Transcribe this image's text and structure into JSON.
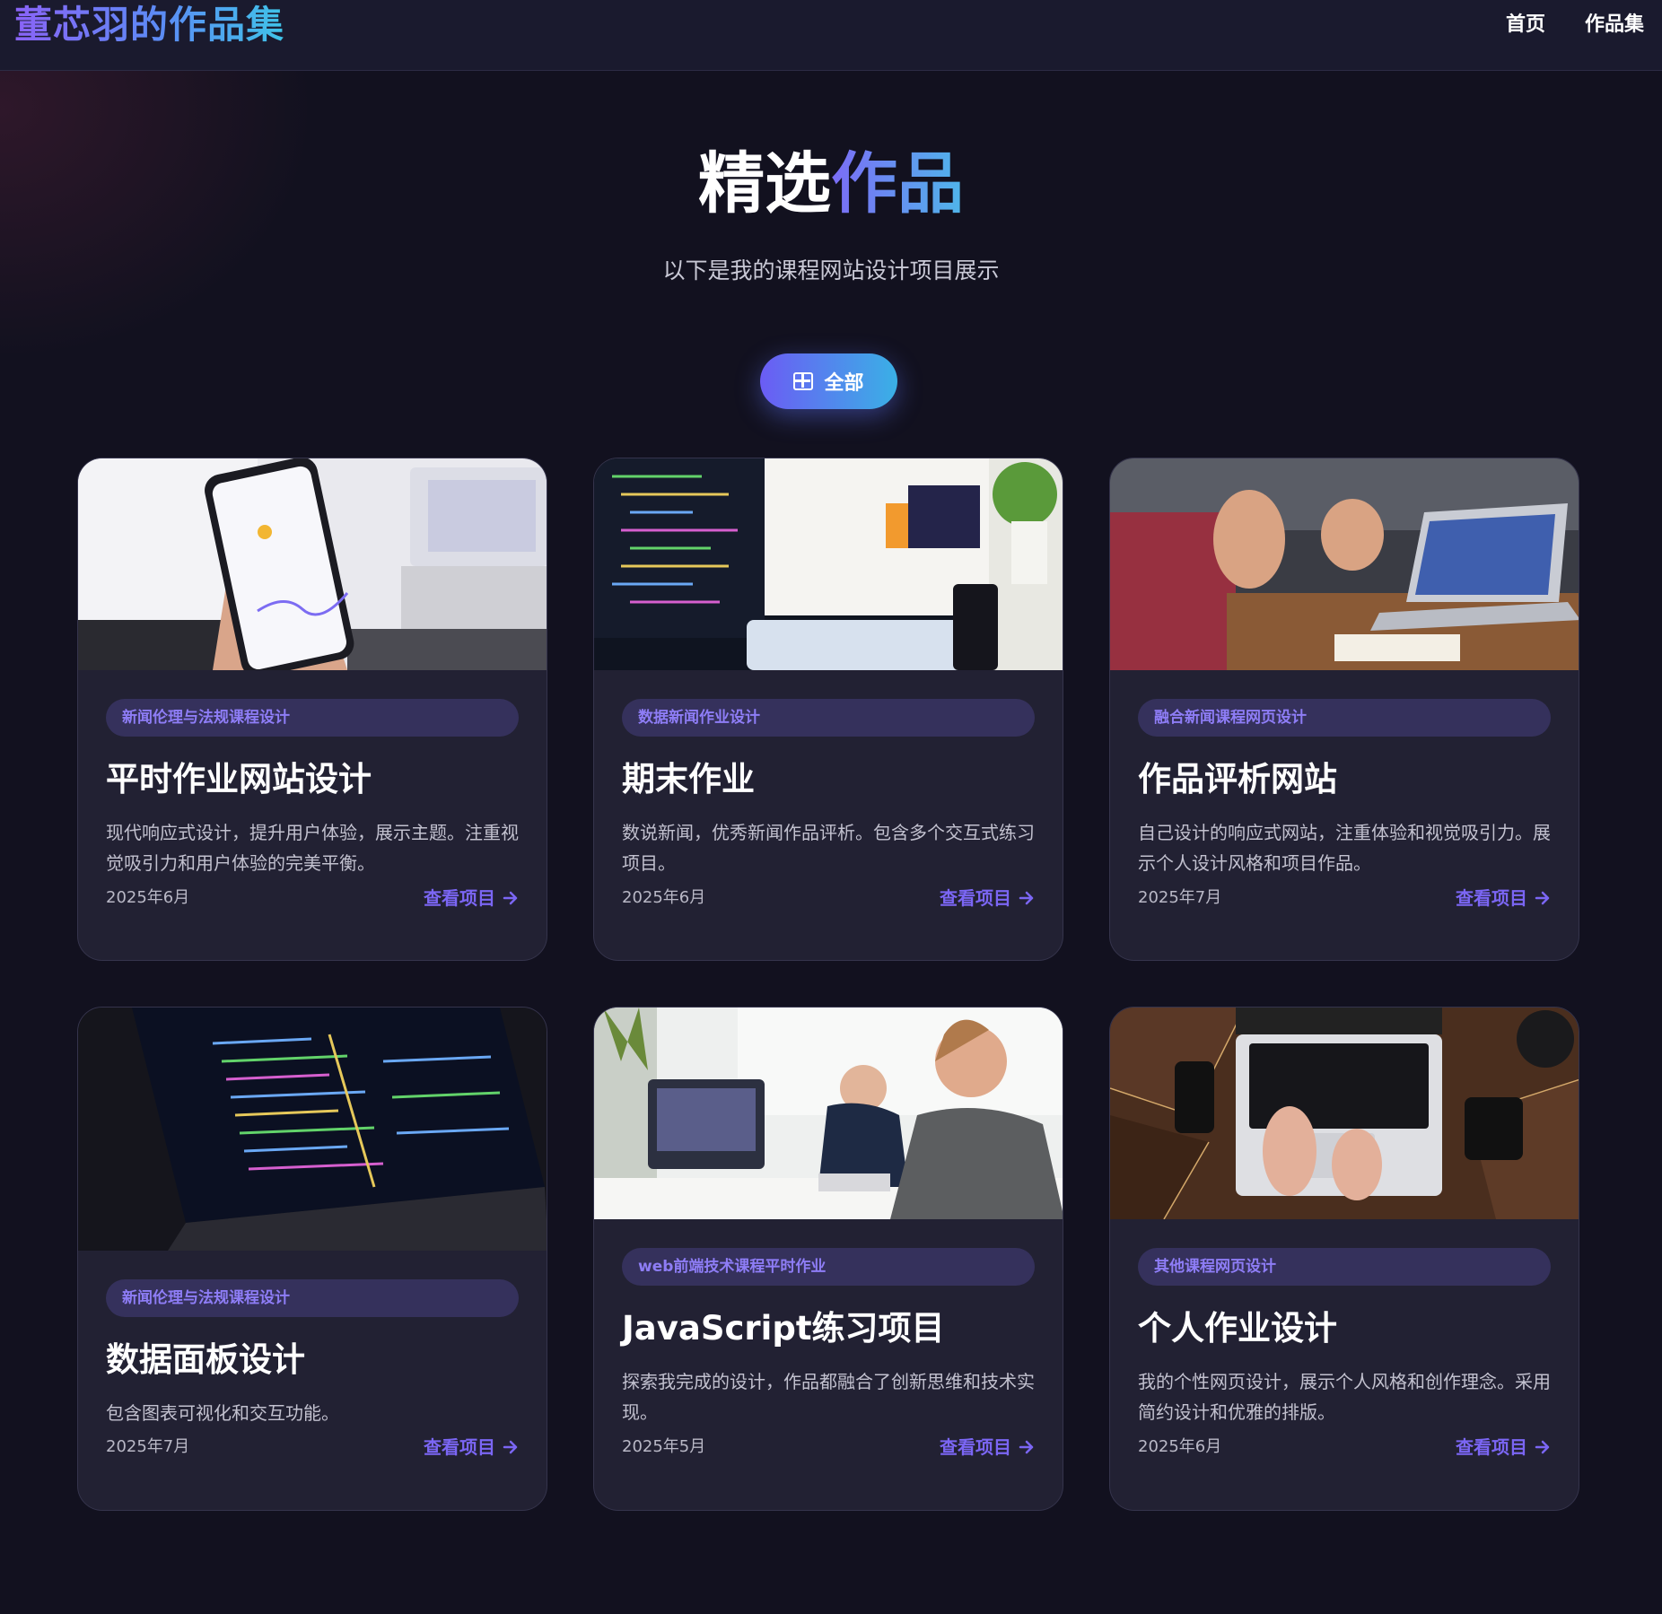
{
  "nav": {
    "brand": "董芯羽的作品集",
    "links": [
      "首页",
      "作品集"
    ]
  },
  "hero": {
    "title_plain": "精选",
    "title_highlight": "作品",
    "subtitle": "以下是我的课程网站设计项目展示",
    "filter_label": "全部"
  },
  "colors": {
    "accent_purple": "#7b66f4",
    "accent_cyan": "#3ab0e6",
    "card_bg": "#222133",
    "page_bg": "#12111f"
  },
  "cards": [
    {
      "image": "phone-dashboard-photo",
      "tag": "新闻伦理与法规课程设计",
      "title": "平时作业网站设计",
      "desc": "现代响应式设计，提升用户体验，展示主题。注重视觉吸引力和用户体验的完美平衡。",
      "date": "2025年6月",
      "link": "查看项目"
    },
    {
      "image": "code-landing-page-photo",
      "tag": "数据新闻作业设计",
      "title": "期末作业",
      "desc": "数说新闻，优秀新闻作品评析。包含多个交互式练习项目。",
      "date": "2025年6月",
      "link": "查看项目"
    },
    {
      "image": "meeting-laptop-photo",
      "tag": "融合新闻课程网页设计",
      "title": "作品评析网站",
      "desc": "自己设计的响应式网站，注重体验和视觉吸引力。展示个人设计风格和项目作品。",
      "date": "2025年7月",
      "link": "查看项目"
    },
    {
      "image": "laptop-code-dark-photo",
      "tag": "新闻伦理与法规课程设计",
      "title": "数据面板设计",
      "desc": "包含图表可视化和交互功能。",
      "date": "2025年7月",
      "link": "查看项目"
    },
    {
      "image": "office-developers-photo",
      "tag": "web前端技术课程平时作业",
      "title": "JavaScript练习项目",
      "desc": "探索我完成的设计，作品都融合了创新思维和技术实现。",
      "date": "2025年5月",
      "link": "查看项目"
    },
    {
      "image": "typing-laptop-desk-photo",
      "tag": "其他课程网页设计",
      "title": "个人作业设计",
      "desc": "我的个性网页设计，展示个人风格和创作理念。采用简约设计和优雅的排版。",
      "date": "2025年6月",
      "link": "查看项目"
    }
  ]
}
